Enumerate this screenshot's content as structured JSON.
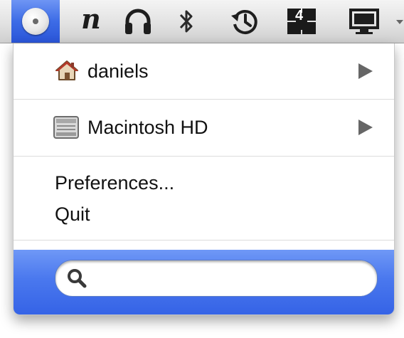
{
  "menubar": {
    "items": [
      {
        "icon": "disc-icon",
        "active": true
      },
      {
        "icon": "n-icon",
        "glyph": "n"
      },
      {
        "icon": "headphones-icon"
      },
      {
        "icon": "bluetooth-icon",
        "glyph": "∗"
      },
      {
        "icon": "time-machine-icon"
      },
      {
        "icon": "spaces-icon",
        "badge": "4"
      },
      {
        "icon": "display-icon"
      }
    ]
  },
  "menu": {
    "items": [
      {
        "label": "daniels",
        "icon": "home-icon",
        "submenu": true
      },
      {
        "label": "Macintosh HD",
        "icon": "hard-drive-icon",
        "submenu": true
      }
    ],
    "preferences_label": "Preferences...",
    "quit_label": "Quit",
    "search": {
      "value": "",
      "icon": "magnifier-icon"
    }
  },
  "colors": {
    "accent": "#3d6ce6",
    "menubar": "#e2e2e2"
  }
}
